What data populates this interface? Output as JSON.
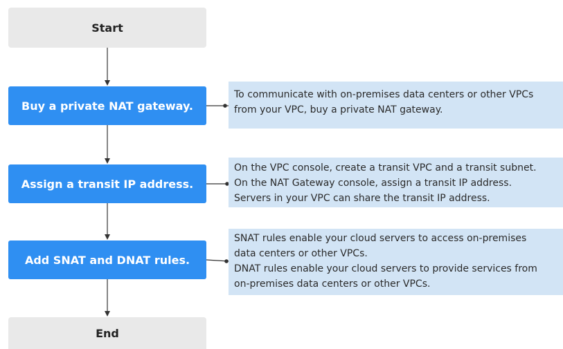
{
  "start_label": "Start",
  "end_label": "End",
  "steps": [
    {
      "label": "Buy a private NAT gateway.",
      "note_lines": [
        "To communicate with on-premises data centers or other VPCs",
        "from your VPC, buy a private NAT gateway."
      ]
    },
    {
      "label": "Assign a transit IP address.",
      "note_lines": [
        "On the VPC console, create a transit VPC and a transit subnet.",
        "On the NAT Gateway console, assign a transit IP address.",
        "Servers in your VPC can share the transit IP address."
      ]
    },
    {
      "label": "Add SNAT and DNAT rules.",
      "note_lines": [
        "SNAT rules enable your cloud servers to access on-premises",
        "data centers or other VPCs.",
        "DNAT rules enable your cloud servers to provide services from",
        "on-premises data centers or other VPCs."
      ]
    }
  ],
  "colors": {
    "terminal_fill": "#e9e9e9",
    "step_fill": "#2f8ff2",
    "note_fill": "#d2e4f5",
    "connector": "#333333"
  }
}
